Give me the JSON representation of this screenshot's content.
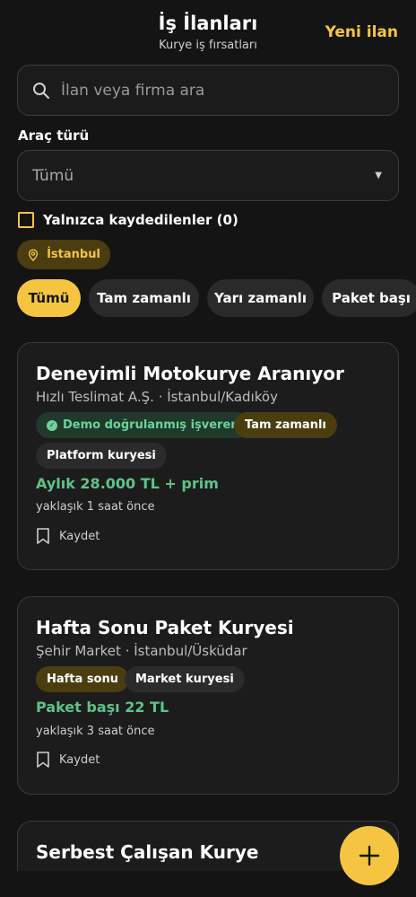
{
  "header": {
    "title": "İş İlanları",
    "subtitle": "Kurye iş fırsatları",
    "new_button": "Yeni ilan"
  },
  "search": {
    "placeholder": "İlan veya firma ara",
    "value": ""
  },
  "vehicle": {
    "label": "Araç türü",
    "selected": "Tümü"
  },
  "saved_only": {
    "label": "Yalnızca kaydedilenler (0)",
    "checked": false
  },
  "location_chip": {
    "label": "İstanbul",
    "icon": "location-pin-icon"
  },
  "filters": [
    {
      "label": "Tümü",
      "active": true
    },
    {
      "label": "Tam zamanlı",
      "active": false
    },
    {
      "label": "Yarı zamanlı",
      "active": false
    },
    {
      "label": "Paket başı",
      "active": false
    }
  ],
  "jobs": [
    {
      "title": "Deneyimli Motokurye Aranıyor",
      "company_location": "Hızlı Teslimat A.Ş. · İstanbul/Kadıköy",
      "tags": [
        "Demo doğrulanmış işveren",
        "Tam zamanlı",
        "Platform kuryesi"
      ],
      "salary": "Aylık 28.000 TL + prim",
      "posted": "yaklaşık 1 saat önce",
      "save_label": "Kaydet"
    },
    {
      "title": "Hafta Sonu Paket Kuryesi",
      "company_location": "Şehir Market · İstanbul/Üsküdar",
      "tags": [
        "Hafta sonu",
        "Market kuryesi"
      ],
      "salary": "Paket başı 22 TL",
      "posted": "yaklaşık 3 saat önce",
      "save_label": "Kaydet"
    },
    {
      "title": "Serbest Çalışan Kurye"
    }
  ],
  "colors": {
    "background": "#141414",
    "accent": "#f5c542",
    "salary": "#5ec38a",
    "verified": "#6ed29a"
  }
}
